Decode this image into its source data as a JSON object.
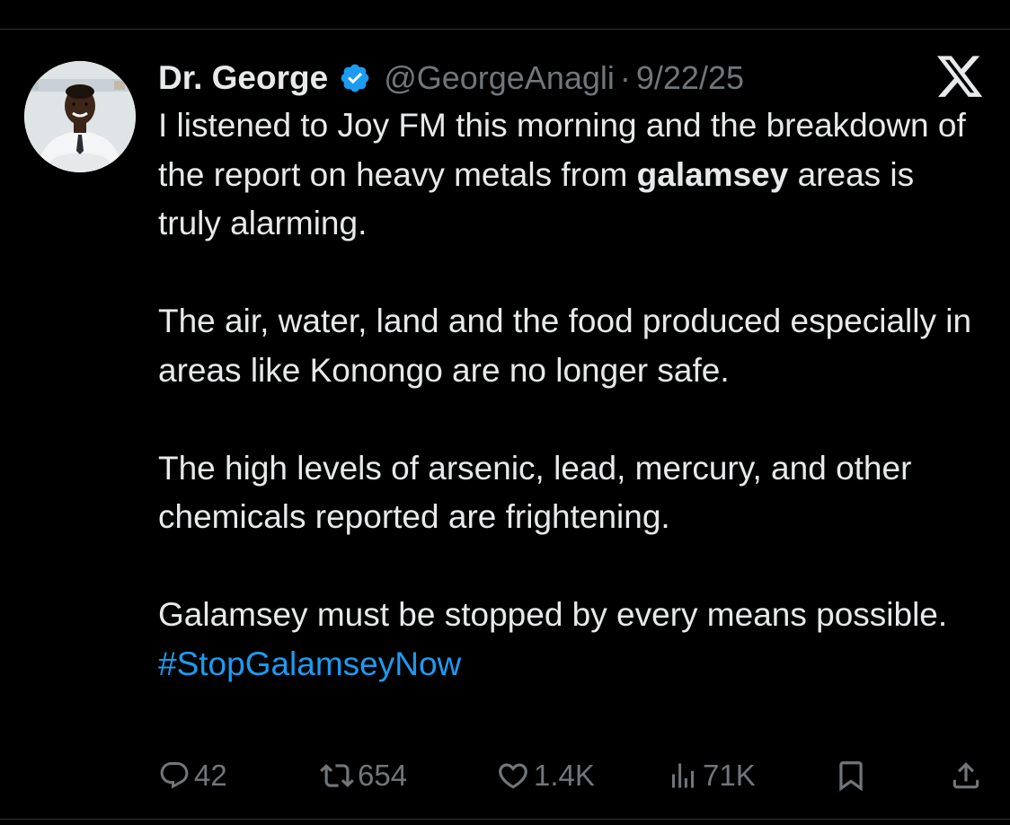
{
  "author": {
    "display_name": "Dr. George",
    "handle": "@GeorgeAnagli",
    "separator": "·",
    "date": "9/22/25",
    "verified": true
  },
  "tweet": {
    "p1_before": "I listened to Joy FM this morning and the breakdown of the report on heavy metals from ",
    "p1_bold": "galamsey",
    "p1_after": " areas is truly alarming.",
    "p2": "The air, water, land and the food produced especially in areas like Konongo are no longer safe.",
    "p3": "The high levels of arsenic, lead, mercury, and other chemicals reported are frightening.",
    "p4_before": "Galamsey must be stopped by every means possible. ",
    "hashtag": "#StopGalamseyNow"
  },
  "actions": {
    "replies": "42",
    "reposts": "654",
    "likes": "1.4K",
    "views": "71K"
  },
  "icons": {
    "verified": "verified-badge-icon",
    "x_logo": "x-logo-icon",
    "reply": "reply-icon",
    "repost": "repost-icon",
    "like": "heart-icon",
    "views": "views-chart-icon",
    "bookmark": "bookmark-icon",
    "share": "share-icon"
  },
  "colors": {
    "background": "#000000",
    "text": "#e7e9ea",
    "secondary": "#71767b",
    "link": "#1d9bf0",
    "verified": "#1d9bf0"
  }
}
